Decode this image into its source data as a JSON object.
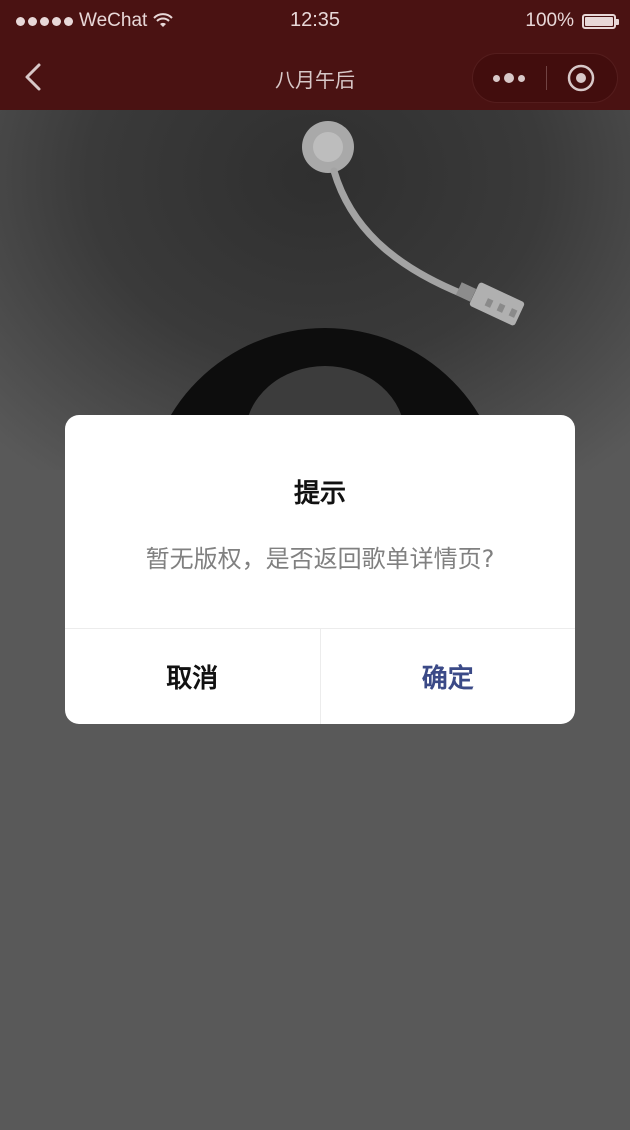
{
  "status_bar": {
    "carrier": "WeChat",
    "time": "12:35",
    "battery_text": "100%",
    "battery_level": 1.0
  },
  "nav_bar": {
    "title": "八月午后",
    "back_icon": "chevron-left-icon",
    "menu_icon": "more-dots-icon",
    "close_icon": "target-close-icon",
    "background": "#4a1212"
  },
  "modal": {
    "title": "提示",
    "content": "暂无版权，是否返回歌单详情页?",
    "cancel_label": "取消",
    "confirm_label": "确定",
    "confirm_color": "#3b4a87"
  }
}
